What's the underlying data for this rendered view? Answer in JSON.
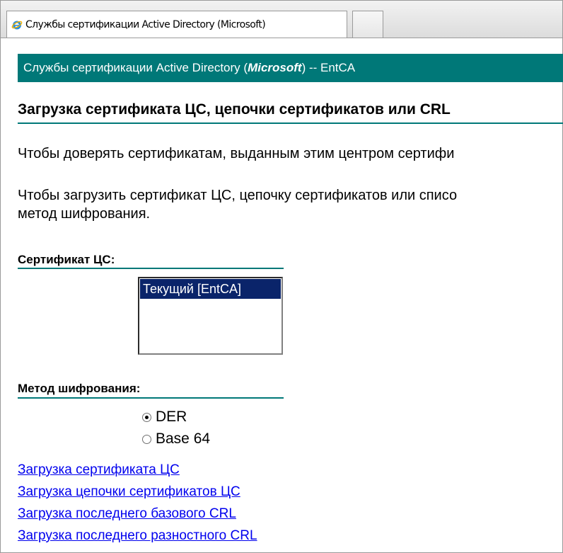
{
  "tab": {
    "title": "Службы сертификации Active Directory (Microsoft)",
    "icon": "internet-explorer-icon"
  },
  "banner": {
    "prefix": "Службы сертификации Active Directory (",
    "brand": "Microsoft",
    "suffix": ")  --  EntCA"
  },
  "heading": "Загрузка сертификата ЦС, цепочки сертификатов или CRL",
  "paragraphs": {
    "p1": "Чтобы доверять сертификатам, выданным этим центром сертифи",
    "p2_line1": "Чтобы загрузить сертификат ЦС, цепочку сертификатов или списо",
    "p2_line2": "метод шифрования."
  },
  "ca_certificate": {
    "label": "Сертификат ЦС:",
    "items": [
      "Текущий [EntCA]"
    ],
    "selected": "Текущий [EntCA]"
  },
  "encoding": {
    "label": "Метод шифрования:",
    "options": [
      "DER",
      "Base 64"
    ],
    "selected": "DER"
  },
  "links": [
    "Загрузка сертификата ЦС",
    "Загрузка цепочки сертификатов ЦС",
    "Загрузка последнего базового CRL",
    "Загрузка последнего разностного CRL"
  ],
  "colors": {
    "accent": "#007878",
    "selection": "#0a246a",
    "link": "#0000ee"
  }
}
